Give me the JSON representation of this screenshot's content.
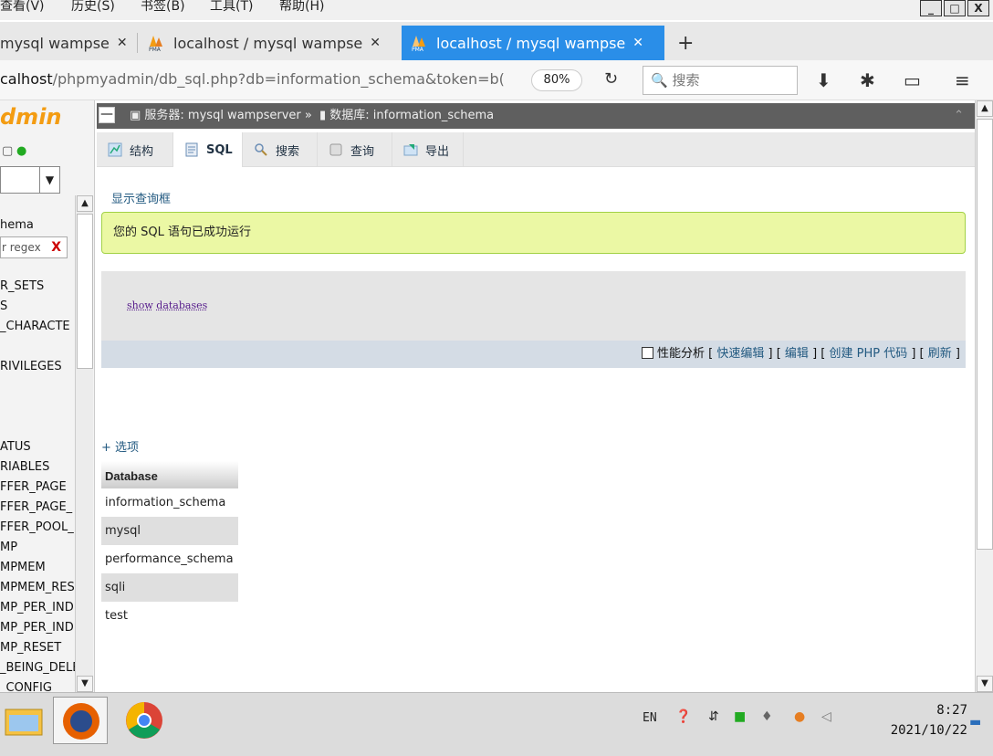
{
  "menu": {
    "items": [
      "查看(V)",
      "历史(S)",
      "书签(B)",
      "工具(T)",
      "帮助(H)"
    ],
    "window_controls": [
      "_",
      "□",
      "X"
    ]
  },
  "tabs": [
    {
      "title": "mysql wampse",
      "active": false
    },
    {
      "title": "localhost / mysql wampse",
      "active": false
    },
    {
      "title": "localhost / mysql wampse",
      "active": true
    }
  ],
  "new_tab_label": "+",
  "address": {
    "host": "calhost",
    "path": "/phpmyadmin/db_sql.php?db=information_schema&token=b(",
    "zoom": "80%",
    "search_placeholder": "搜索"
  },
  "sidebar": {
    "logo": "dmin",
    "select_arrow": "▼",
    "db_name": "hema",
    "filter_placeholder": "r regex",
    "filter_clear": "X",
    "tree_items": [
      "R_SETS",
      "S",
      "_CHARACTE",
      "RIVILEGES",
      "ATUS",
      "RIABLES",
      "FFER_PAGE",
      "FFER_PAGE_",
      "FFER_POOL_",
      "MP",
      "MPMEM",
      "MPMEM_RES",
      "MP_PER_INDI",
      "MP_PER_INDI",
      "MP_RESET",
      "_BEING_DELE",
      "_CONFIG"
    ]
  },
  "breadcrumb": {
    "collapse": "—",
    "server_label": "服务器: mysql wampserver »",
    "db_label": "数据库: information_schema",
    "toggle": "⌃"
  },
  "topmenu": [
    {
      "label": "结构",
      "active": false
    },
    {
      "label": "SQL",
      "active": true
    },
    {
      "label": "搜索",
      "active": false
    },
    {
      "label": "查询",
      "active": false
    },
    {
      "label": "导出",
      "active": false
    }
  ],
  "main": {
    "show_query": "显示查询框",
    "success_msg": "您的 SQL 语句已成功运行",
    "sql_text_a": "show",
    "sql_text_b": "databases",
    "profiling": "性能分析",
    "actions": [
      "快速编辑",
      "编辑",
      "创建 PHP 代码",
      "刷新"
    ],
    "options": "+ 选项"
  },
  "results": {
    "header": "Database",
    "rows": [
      "information_schema",
      "mysql",
      "performance_schema",
      "sqli",
      "test"
    ]
  },
  "taskbar": {
    "lang": "EN",
    "time": "8:27",
    "date": "2021/10/22"
  }
}
